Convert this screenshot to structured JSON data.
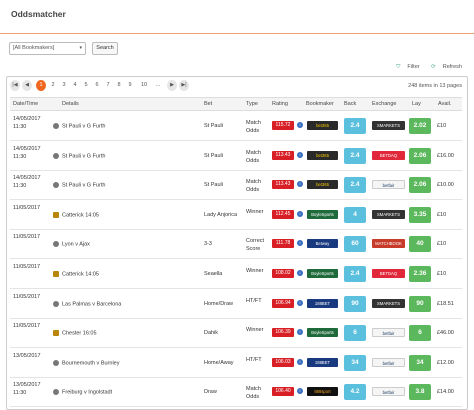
{
  "page": {
    "title": "Oddsmatcher"
  },
  "filters": {
    "bookmaker_select": "[All Bookmakers]",
    "search_label": "Search"
  },
  "tools": {
    "filter_label": "Filter",
    "refresh_label": "Refresh"
  },
  "pager": {
    "prev_first": "|◀",
    "prev": "◀",
    "pages": [
      "1",
      "2",
      "3",
      "4",
      "5",
      "6",
      "7",
      "8",
      "9",
      "10",
      "..."
    ],
    "next": "▶",
    "next_last": "▶|",
    "items_info": "248 items in 13 pages"
  },
  "columns": [
    "Date/Time",
    "Details",
    "Bet",
    "Type",
    "Rating",
    "Bookmaker",
    "Back",
    "Exchange",
    "Lay",
    "Avail."
  ],
  "rows": [
    {
      "date": "14/05/2017",
      "time": "11:30",
      "event": "St Pauli v G Furth",
      "icon": "football",
      "bet": "St Pauli",
      "type1": "Match",
      "type2": "Odds",
      "rating": "115.72",
      "bookmaker": "bet365",
      "bm_style": "bet365",
      "back": "2.4",
      "exchange": "SMARKETS",
      "ex_style": "smarkets",
      "lay": "2.02",
      "avail": "£10"
    },
    {
      "date": "14/05/2017",
      "time": "11:30",
      "event": "St Pauli v G Furth",
      "icon": "football",
      "bet": "St Pauli",
      "type1": "Match",
      "type2": "Odds",
      "rating": "113.43",
      "bookmaker": "bet365",
      "bm_style": "bet365",
      "back": "2.4",
      "exchange": "BETDAQ",
      "ex_style": "betdaq",
      "lay": "2.06",
      "avail": "£16.00"
    },
    {
      "date": "14/05/2017",
      "time": "11:30",
      "event": "St Pauli v G Furth",
      "icon": "football",
      "bet": "St Pauli",
      "type1": "Match",
      "type2": "Odds",
      "rating": "113.43",
      "bookmaker": "bet365",
      "bm_style": "bet365",
      "back": "2.4",
      "exchange": "betfair",
      "ex_style": "betfair",
      "lay": "2.06",
      "avail": "£10.00"
    },
    {
      "date": "11/05/2017",
      "time": "",
      "event": "Catterick 14:05",
      "icon": "horse",
      "bet": "Lady Anjorica",
      "type1": "Winner",
      "type2": "",
      "rating": "112.45",
      "bookmaker": "BoyleSports",
      "bm_style": "bm",
      "back": "4",
      "exchange": "SMARKETS",
      "ex_style": "smarkets",
      "lay": "3.35",
      "avail": "£10"
    },
    {
      "date": "11/05/2017",
      "time": "",
      "event": "Lyon v Ajax",
      "icon": "football",
      "bet": "3-3",
      "type1": "Correct",
      "type2": "Score",
      "rating": "111.78",
      "bookmaker": "Betway",
      "bm_style": "blue",
      "back": "60",
      "exchange": "MATCHBOOK",
      "ex_style": "matchbook",
      "lay": "40",
      "avail": "£10"
    },
    {
      "date": "11/05/2017",
      "time": "",
      "event": "Catterick 14:05",
      "icon": "horse",
      "bet": "Seaella",
      "type1": "Winner",
      "type2": "",
      "rating": "108.02",
      "bookmaker": "BoyleSports",
      "bm_style": "bm",
      "back": "2.4",
      "exchange": "BETDAQ",
      "ex_style": "betdaq",
      "lay": "2.36",
      "avail": "£10"
    },
    {
      "date": "11/05/2017",
      "time": "",
      "event": "Las Palmas v Barcelona",
      "icon": "football",
      "bet": "Home/Draw",
      "type1": "HT/FT",
      "type2": "",
      "rating": "106.94",
      "bookmaker": "188BET",
      "bm_style": "blue",
      "back": "90",
      "exchange": "SMARKETS",
      "ex_style": "smarkets",
      "lay": "90",
      "avail": "£18.51"
    },
    {
      "date": "11/05/2017",
      "time": "",
      "event": "Chester 16:05",
      "icon": "horse",
      "bet": "Dahik",
      "type1": "Winner",
      "type2": "",
      "rating": "106.39",
      "bookmaker": "BoyleSports",
      "bm_style": "bm",
      "back": "6",
      "exchange": "betfair",
      "ex_style": "betfair",
      "lay": "6",
      "avail": "£46.00"
    },
    {
      "date": "13/05/2017",
      "time": "",
      "event": "Bournemouth v Burnley",
      "icon": "football",
      "bet": "Home/Away",
      "type1": "HT/FT",
      "type2": "",
      "rating": "106.03",
      "bookmaker": "188BET",
      "bm_style": "blue",
      "back": "34",
      "exchange": "betfair",
      "ex_style": "betfair",
      "lay": "34",
      "avail": "£12.00"
    },
    {
      "date": "13/05/2017",
      "time": "11:30",
      "event": "Freiburg v Ingolstadt",
      "icon": "football",
      "bet": "Draw",
      "type1": "Match",
      "type2": "Odds",
      "rating": "106.40",
      "bookmaker": "888sport",
      "bm_style": "888",
      "back": "4.2",
      "exchange": "betfair",
      "ex_style": "betfair",
      "lay": "3.8",
      "avail": "£14.00"
    }
  ],
  "colors": {
    "accent": "#f06820",
    "back": "#5bc0de",
    "lay": "#5cb85c",
    "rating": "#d81f26"
  }
}
